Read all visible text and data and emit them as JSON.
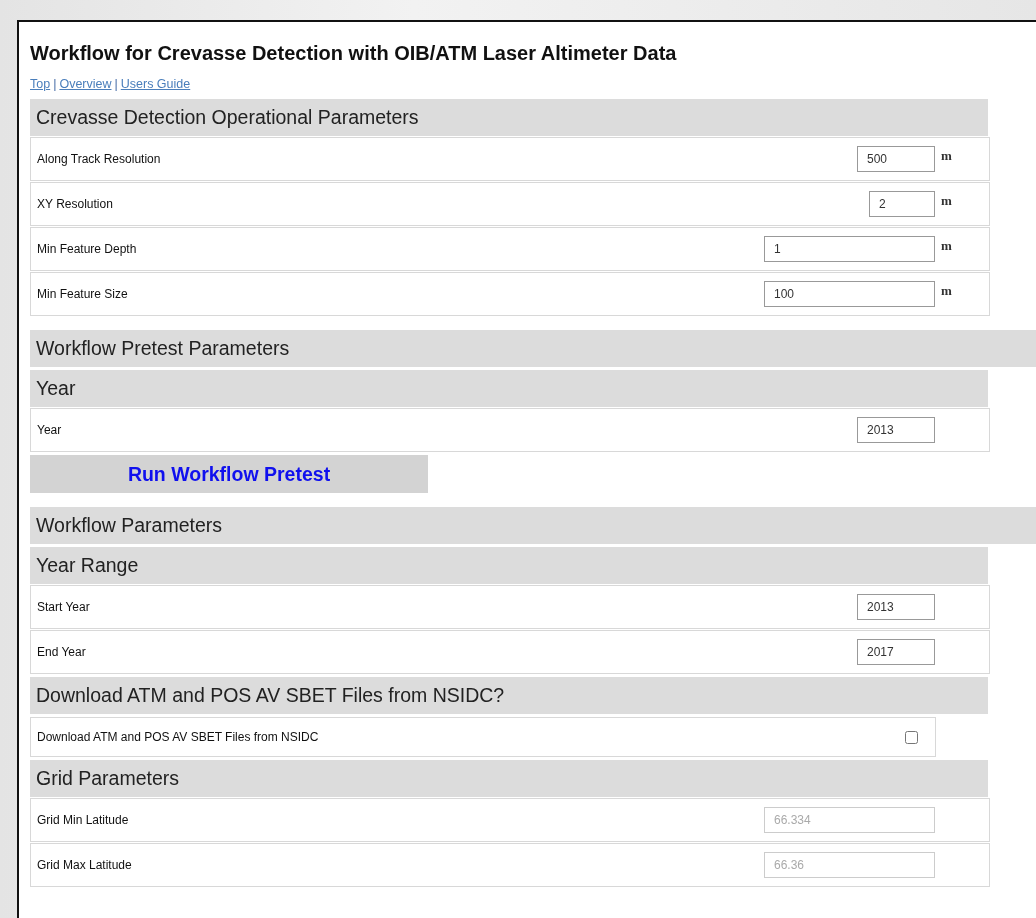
{
  "title": "Workflow for Crevasse Detection with OIB/ATM Laser Altimeter Data",
  "nav": [
    {
      "kind": "link",
      "text": "Top"
    },
    {
      "kind": "separator",
      "text": "|"
    },
    {
      "kind": "link",
      "text": "Overview"
    },
    {
      "kind": "separator",
      "text": "|"
    },
    {
      "kind": "link",
      "text": "Users Guide"
    }
  ],
  "blocks": [
    {
      "kind": "group",
      "text": "Crevasse Detection Operational Parameters"
    },
    {
      "kind": "field",
      "label": "Along Track Resolution",
      "value": "500",
      "unit": "m",
      "disabled": false
    },
    {
      "kind": "field",
      "label": "XY Resolution",
      "value": "2",
      "unit": "m",
      "disabled": false
    },
    {
      "kind": "field",
      "label": "Min Feature Depth",
      "value": "1",
      "unit": "m",
      "disabled": false
    },
    {
      "kind": "field",
      "label": "Min Feature Size",
      "value": "100",
      "unit": "m",
      "disabled": false
    },
    {
      "kind": "section",
      "text": "Workflow Pretest Parameters"
    },
    {
      "kind": "group",
      "text": "Year"
    },
    {
      "kind": "field",
      "label": "Year",
      "value": "2013",
      "disabled": false
    },
    {
      "kind": "button",
      "text": "Run Workflow Pretest"
    },
    {
      "kind": "section",
      "text": "Workflow Parameters"
    },
    {
      "kind": "group",
      "text": "Year Range"
    },
    {
      "kind": "field",
      "label": "Start Year",
      "value": "2013",
      "disabled": false
    },
    {
      "kind": "field",
      "label": "End Year",
      "value": "2017",
      "disabled": false
    },
    {
      "kind": "group",
      "text": "Download ATM and POS AV SBET Files from NSIDC?"
    },
    {
      "kind": "checkbox",
      "label": "Download ATM and POS AV SBET Files from NSIDC",
      "checked": false
    },
    {
      "kind": "group",
      "text": "Grid Parameters"
    },
    {
      "kind": "field",
      "label": "Grid Min Latitude",
      "placeholder": "66.334",
      "disabled": true
    },
    {
      "kind": "field",
      "label": "Grid Max Latitude",
      "placeholder": "66.36",
      "disabled": true
    }
  ]
}
